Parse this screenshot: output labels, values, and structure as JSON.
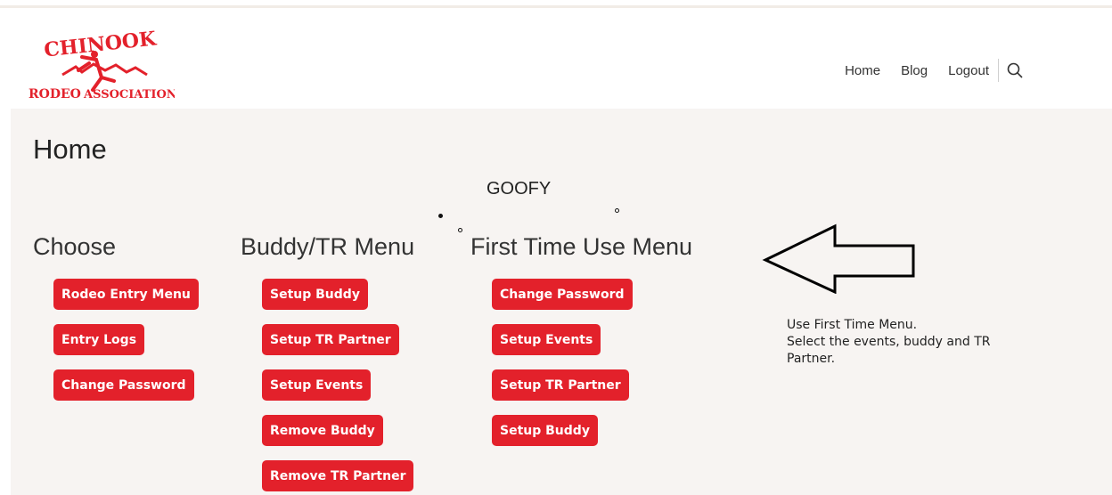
{
  "brand": {
    "logo_top": "CHINOOK",
    "logo_bottom_left": "RODEO",
    "logo_bottom_right": "ASSOCIATION",
    "accent": "#e3212b"
  },
  "nav": {
    "items": [
      "Home",
      "Blog",
      "Logout"
    ],
    "search_icon": "search-icon"
  },
  "page": {
    "title": "Home",
    "annotation_name": "GOOFY"
  },
  "columns": [
    {
      "heading": "Choose",
      "buttons": [
        "Rodeo Entry Menu",
        "Entry Logs",
        "Change Password"
      ]
    },
    {
      "heading": "Buddy/TR Menu",
      "buttons": [
        "Setup Buddy",
        "Setup TR Partner",
        "Setup Events",
        "Remove Buddy",
        "Remove TR Partner"
      ]
    },
    {
      "heading": "First Time Use Menu",
      "buttons": [
        "Change Password",
        "Setup Events",
        "Setup TR Partner",
        "Setup Buddy"
      ]
    }
  ],
  "note": {
    "line1": "Use First Time Menu.",
    "line2": "Select the events, buddy and TR Partner."
  }
}
